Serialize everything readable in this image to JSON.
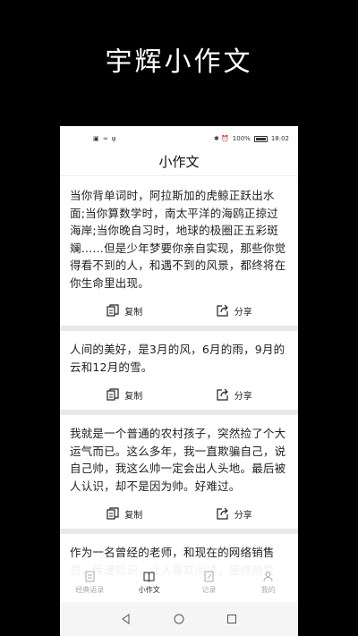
{
  "promo": {
    "title": "宇辉小作文"
  },
  "status": {
    "left_icons": "▣ ≈ ψ",
    "right_icons": "✱ ⏰",
    "battery": "100%",
    "time": "18:02"
  },
  "app": {
    "title": "小作文"
  },
  "cards": [
    {
      "text": "当你背单词时，阿拉斯加的虎鲸正跃出水面;当你算数学时，南太平洋的海鸥正掠过海岸;当你晚自习时，地球的极圈正五彩斑斓……但是少年梦要你亲自实现，那些你觉得看不到的人，和遇不到的风景，都终将在你生命里出现。",
      "copy_label": "复制",
      "share_label": "分享"
    },
    {
      "text": "人间的美好，是3月的风，6月的雨，9月的云和12月的雪。",
      "copy_label": "复制",
      "share_label": "分享"
    },
    {
      "text": "我就是一个普通的农村孩子，突然捡了个大运气而已。这么多年，我一直欺骗自己，说自己帅，我这么帅一定会出人头地。最后被人认识，却不是因为帅。好难过。",
      "copy_label": "复制",
      "share_label": "分享"
    },
    {
      "text": "作为一名曾经的老师，和现在的网络销售员，传递知识，让人喜欢阅读，是终热爱"
    }
  ],
  "tabs": [
    {
      "label": "经典语录",
      "icon": "book-page-icon",
      "active": false
    },
    {
      "label": "小作文",
      "icon": "open-book-icon",
      "active": true
    },
    {
      "label": "记录",
      "icon": "edit-note-icon",
      "active": false
    },
    {
      "label": "我的",
      "icon": "person-icon",
      "active": false
    }
  ],
  "colors": {
    "page_bg": "#000000",
    "card_bg": "#ffffff",
    "divider": "#e8e8e8",
    "tab_inactive": "#aaaaaa",
    "tab_active": "#222222"
  }
}
